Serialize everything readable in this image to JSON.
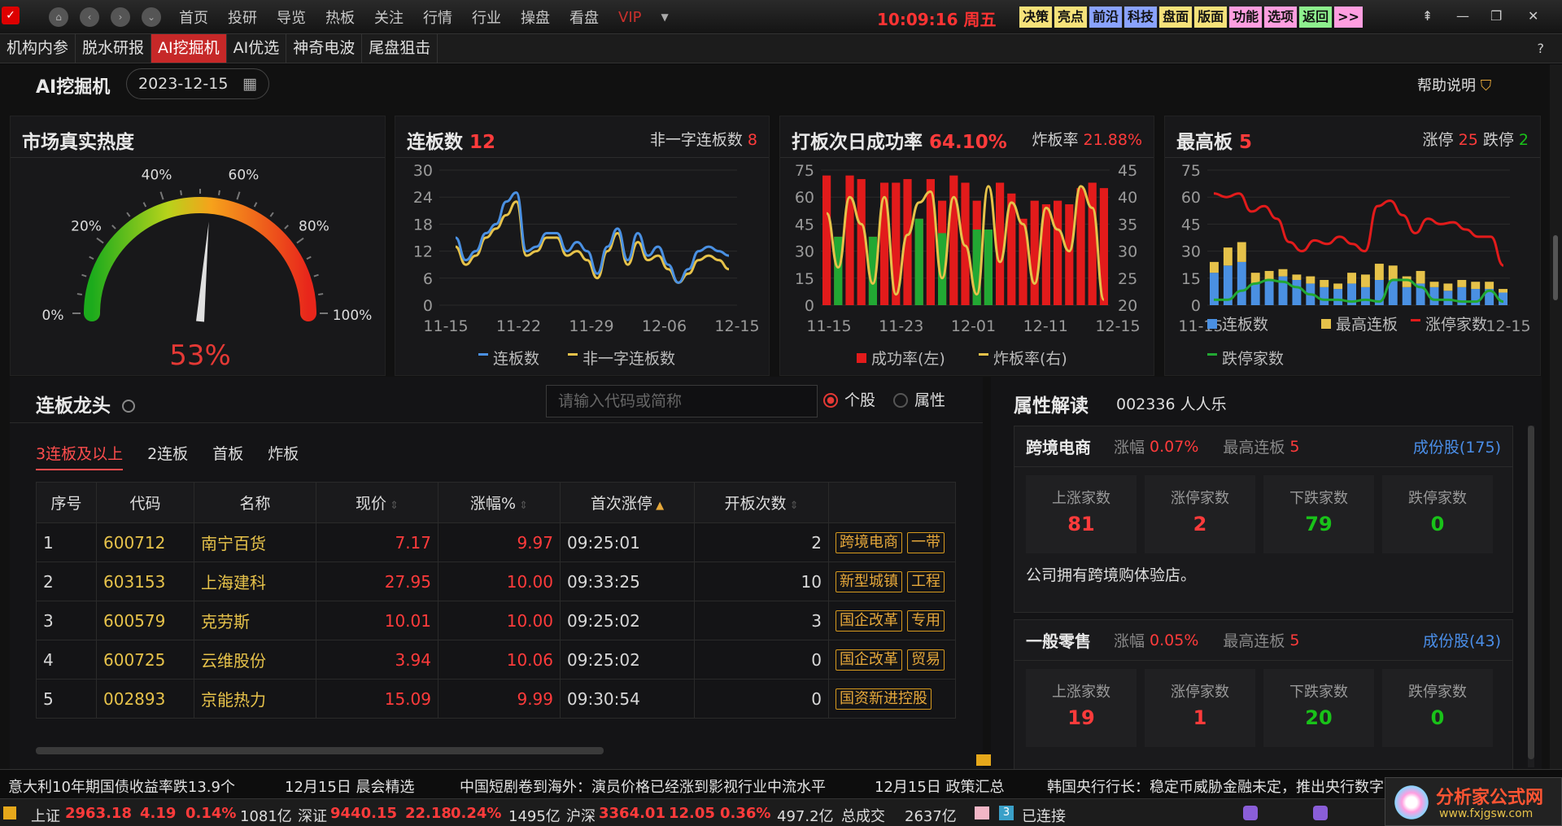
{
  "topbar": {
    "nav": [
      "首页",
      "投研",
      "导览",
      "热板",
      "关注",
      "行情",
      "行业",
      "操盘",
      "看盘",
      "VIP"
    ],
    "clock": "10:09:16",
    "weekday": "周五",
    "quick": [
      {
        "label": "决策",
        "color": "#f6e27a"
      },
      {
        "label": "亮点",
        "color": "#f6e27a"
      },
      {
        "label": "前沿",
        "color": "#8aa3ff"
      },
      {
        "label": "科技",
        "color": "#8aa3ff"
      },
      {
        "label": "盘面",
        "color": "#f6e27a"
      },
      {
        "label": "版面",
        "color": "#f6e27a"
      },
      {
        "label": "功能",
        "color": "#ff9ee0"
      },
      {
        "label": "选项",
        "color": "#ff9ee0"
      },
      {
        "label": "返回",
        "color": "#8ef08e"
      },
      {
        "label": ">>",
        "color": "#ff9ee0"
      }
    ]
  },
  "tabs": [
    "机构内参",
    "脱水研报",
    "AI挖掘机",
    "AI优选",
    "神奇电波",
    "尾盘狙击"
  ],
  "active_tab": "AI挖掘机",
  "header": {
    "title": "AI挖掘机",
    "date": "2023-12-15",
    "help": "帮助说明",
    "question": "?"
  },
  "heat": {
    "title": "市场真实热度",
    "ticks": [
      "0%",
      "20%",
      "40%",
      "60%",
      "80%",
      "100%"
    ],
    "value_label": "53%",
    "value": 0.53
  },
  "lianban": {
    "title": "连板数",
    "count": "12",
    "right_label": "非一字连板数",
    "right_value": "8",
    "legend": [
      "连板数",
      "非一字连板数"
    ]
  },
  "daban": {
    "title": "打板次日成功率",
    "rate": "64.10%",
    "right_label": "炸板率",
    "right_value": "21.88%",
    "legend": [
      "成功率(左)",
      "炸板率(右)"
    ]
  },
  "zuigao": {
    "title": "最高板",
    "count": "5",
    "up_label": "涨停",
    "up": "25",
    "down_label": "跌停",
    "down": "2",
    "legend": [
      "连板数",
      "最高连板",
      "涨停家数",
      "跌停家数"
    ]
  },
  "chart_data": [
    {
      "type": "line",
      "x_ticks": [
        "11-15",
        "11-22",
        "11-29",
        "12-06",
        "12-15"
      ],
      "ylim": [
        0,
        30
      ],
      "y_ticks": [
        0,
        6,
        12,
        18,
        24,
        30
      ],
      "series": [
        {
          "name": "连板数",
          "color": "#4a90e2",
          "values": [
            15,
            10,
            12,
            16,
            18,
            23,
            25,
            12,
            13,
            16,
            16,
            12,
            14,
            12,
            7,
            13,
            17,
            10,
            16,
            11,
            13,
            9,
            5,
            8,
            12,
            13,
            12,
            11
          ]
        },
        {
          "name": "非一字连板数",
          "color": "#e6c24a",
          "values": [
            13,
            9,
            11,
            15,
            17,
            20,
            23,
            11,
            12,
            15,
            15,
            11,
            12,
            10,
            6,
            12,
            16,
            9,
            14,
            10,
            11,
            8,
            5,
            7,
            10,
            11,
            10,
            8
          ]
        }
      ]
    },
    {
      "type": "bar",
      "x_ticks": [
        "11-15",
        "11-23",
        "12-01",
        "12-11",
        "12-15"
      ],
      "ylim_left": [
        0,
        75
      ],
      "y_ticks_left": [
        0,
        15,
        30,
        45,
        60,
        75
      ],
      "ylim_right": [
        20,
        45
      ],
      "y_ticks_right": [
        20,
        25,
        30,
        35,
        40,
        45
      ],
      "series": [
        {
          "name": "成功率(左)",
          "color": "#e21b1b",
          "values": [
            72,
            38,
            72,
            70,
            38,
            68,
            68,
            70,
            48,
            70,
            58,
            72,
            68,
            58,
            42,
            68,
            62,
            48,
            58,
            56,
            58,
            56,
            65,
            68,
            65
          ]
        },
        {
          "name": "成功率(左)-绿",
          "color": "#22a833",
          "values": [
            0,
            38,
            0,
            0,
            38,
            0,
            0,
            0,
            48,
            0,
            40,
            0,
            0,
            42,
            42,
            0,
            0,
            0,
            0,
            0,
            0,
            0,
            0,
            0,
            0
          ]
        },
        {
          "name": "炸板率(右)",
          "color": "#e6c24a",
          "values": [
            37,
            27,
            40,
            35,
            24,
            40,
            22,
            33,
            39,
            41,
            25,
            40,
            31,
            22,
            42,
            28,
            39,
            35,
            24,
            38,
            34,
            30,
            42,
            38,
            21
          ]
        }
      ]
    },
    {
      "type": "bar",
      "x_ticks": [
        "11-15",
        "12-15"
      ],
      "ylim": [
        0,
        75
      ],
      "y_ticks": [
        0,
        15,
        30,
        45,
        60,
        75
      ],
      "series": [
        {
          "name": "连板数",
          "color": "#4a90e2",
          "values": [
            18,
            22,
            24,
            12,
            14,
            16,
            14,
            12,
            10,
            9,
            12,
            10,
            14,
            14,
            10,
            12,
            10,
            8,
            10,
            9,
            9,
            7
          ]
        },
        {
          "name": "最高连板",
          "color": "#e6c24a",
          "values": [
            6,
            10,
            11,
            6,
            5,
            4,
            3,
            4,
            4,
            3,
            6,
            7,
            9,
            8,
            6,
            7,
            3,
            4,
            4,
            4,
            4,
            2
          ]
        },
        {
          "name": "涨停家数",
          "color": "#e21b1b",
          "values": [
            62,
            60,
            62,
            52,
            55,
            48,
            35,
            30,
            36,
            34,
            38,
            34,
            30,
            55,
            58,
            50,
            40,
            48,
            45,
            46,
            42,
            38,
            38,
            22
          ]
        },
        {
          "name": "跌停家数",
          "color": "#22a833",
          "values": [
            3,
            3,
            8,
            12,
            14,
            13,
            10,
            6,
            3,
            3,
            2,
            3,
            2,
            14,
            14,
            10,
            3,
            3,
            2,
            2,
            8,
            2
          ]
        }
      ]
    }
  ],
  "dragon": {
    "title": "连板龙头",
    "search_placeholder": "请输入代码或简称",
    "radio_stock": "个股",
    "radio_attr": "属性",
    "subtabs": [
      "3连板及以上",
      "2连板",
      "首板",
      "炸板"
    ],
    "columns": [
      "序号",
      "代码",
      "名称",
      "现价",
      "涨幅%",
      "首次涨停",
      "开板次数",
      ""
    ],
    "rows": [
      {
        "idx": "1",
        "code": "600712",
        "name": "南宁百货",
        "price": "7.17",
        "pct": "9.97",
        "time": "09:25:01",
        "opens": "2",
        "tags": [
          "跨境电商",
          "一带"
        ]
      },
      {
        "idx": "2",
        "code": "603153",
        "name": "上海建科",
        "price": "27.95",
        "pct": "10.00",
        "time": "09:33:25",
        "opens": "10",
        "tags": [
          "新型城镇",
          "工程"
        ]
      },
      {
        "idx": "3",
        "code": "600579",
        "name": "克劳斯",
        "price": "10.01",
        "pct": "10.00",
        "time": "09:25:02",
        "opens": "3",
        "tags": [
          "国企改革",
          "专用"
        ]
      },
      {
        "idx": "4",
        "code": "600725",
        "name": "云维股份",
        "price": "3.94",
        "pct": "10.06",
        "time": "09:25:02",
        "opens": "0",
        "tags": [
          "国企改革",
          "贸易"
        ]
      },
      {
        "idx": "5",
        "code": "002893",
        "name": "京能热力",
        "price": "15.09",
        "pct": "9.99",
        "time": "09:30:54",
        "opens": "0",
        "tags": [
          "国资新进控股"
        ]
      }
    ]
  },
  "attr": {
    "title": "属性解读",
    "stock": "002336 人人乐",
    "cards": [
      {
        "name": "跨境电商",
        "pct_label": "涨幅",
        "pct": "0.07%",
        "max_label": "最高连板",
        "max": "5",
        "link": "成份股(175)",
        "stats": [
          {
            "l": "上涨家数",
            "v": "81",
            "c": "#ff3b3b"
          },
          {
            "l": "涨停家数",
            "v": "2",
            "c": "#ff3b3b"
          },
          {
            "l": "下跌家数",
            "v": "79",
            "c": "#19c219"
          },
          {
            "l": "跌停家数",
            "v": "0",
            "c": "#19c219"
          }
        ],
        "desc": "公司拥有跨境购体验店。"
      },
      {
        "name": "一般零售",
        "pct_label": "涨幅",
        "pct": "0.05%",
        "max_label": "最高连板",
        "max": "5",
        "link": "成份股(43)",
        "stats": [
          {
            "l": "上涨家数",
            "v": "19",
            "c": "#ff3b3b"
          },
          {
            "l": "涨停家数",
            "v": "1",
            "c": "#ff3b3b"
          },
          {
            "l": "下跌家数",
            "v": "20",
            "c": "#19c219"
          },
          {
            "l": "跌停家数",
            "v": "0",
            "c": "#19c219"
          }
        ],
        "desc": ""
      }
    ]
  },
  "ticker": [
    "意大利10年期国债收益率跌13.9个",
    "12月15日 晨会精选",
    "中国短剧卷到海外：演员价格已经涨到影视行业中流水平",
    "12月15日 政策汇总",
    "韩国央行行长：稳定币威胁金融未定，推出央行数字货币"
  ],
  "status": {
    "sh_label": "上证",
    "sh": "2963.18",
    "sh_chg": "4.19",
    "sh_pct": "0.14%",
    "sh_amt": "1081亿",
    "sz_label": "深证",
    "sz": "9440.15",
    "sz_chg": "22.18",
    "sz_pct": "0.24%",
    "sz_amt": "1495亿",
    "hs_label": "沪深",
    "hs": "3364.01",
    "hs_chg": "12.05",
    "hs_pct": "0.36%",
    "hs_amt": "497.2亿",
    "total_label": "总成交",
    "total": "2637亿",
    "conn": "已连接"
  },
  "watermark": {
    "t1": "分析家公式网",
    "t2": "www.fxjgsw.com"
  }
}
